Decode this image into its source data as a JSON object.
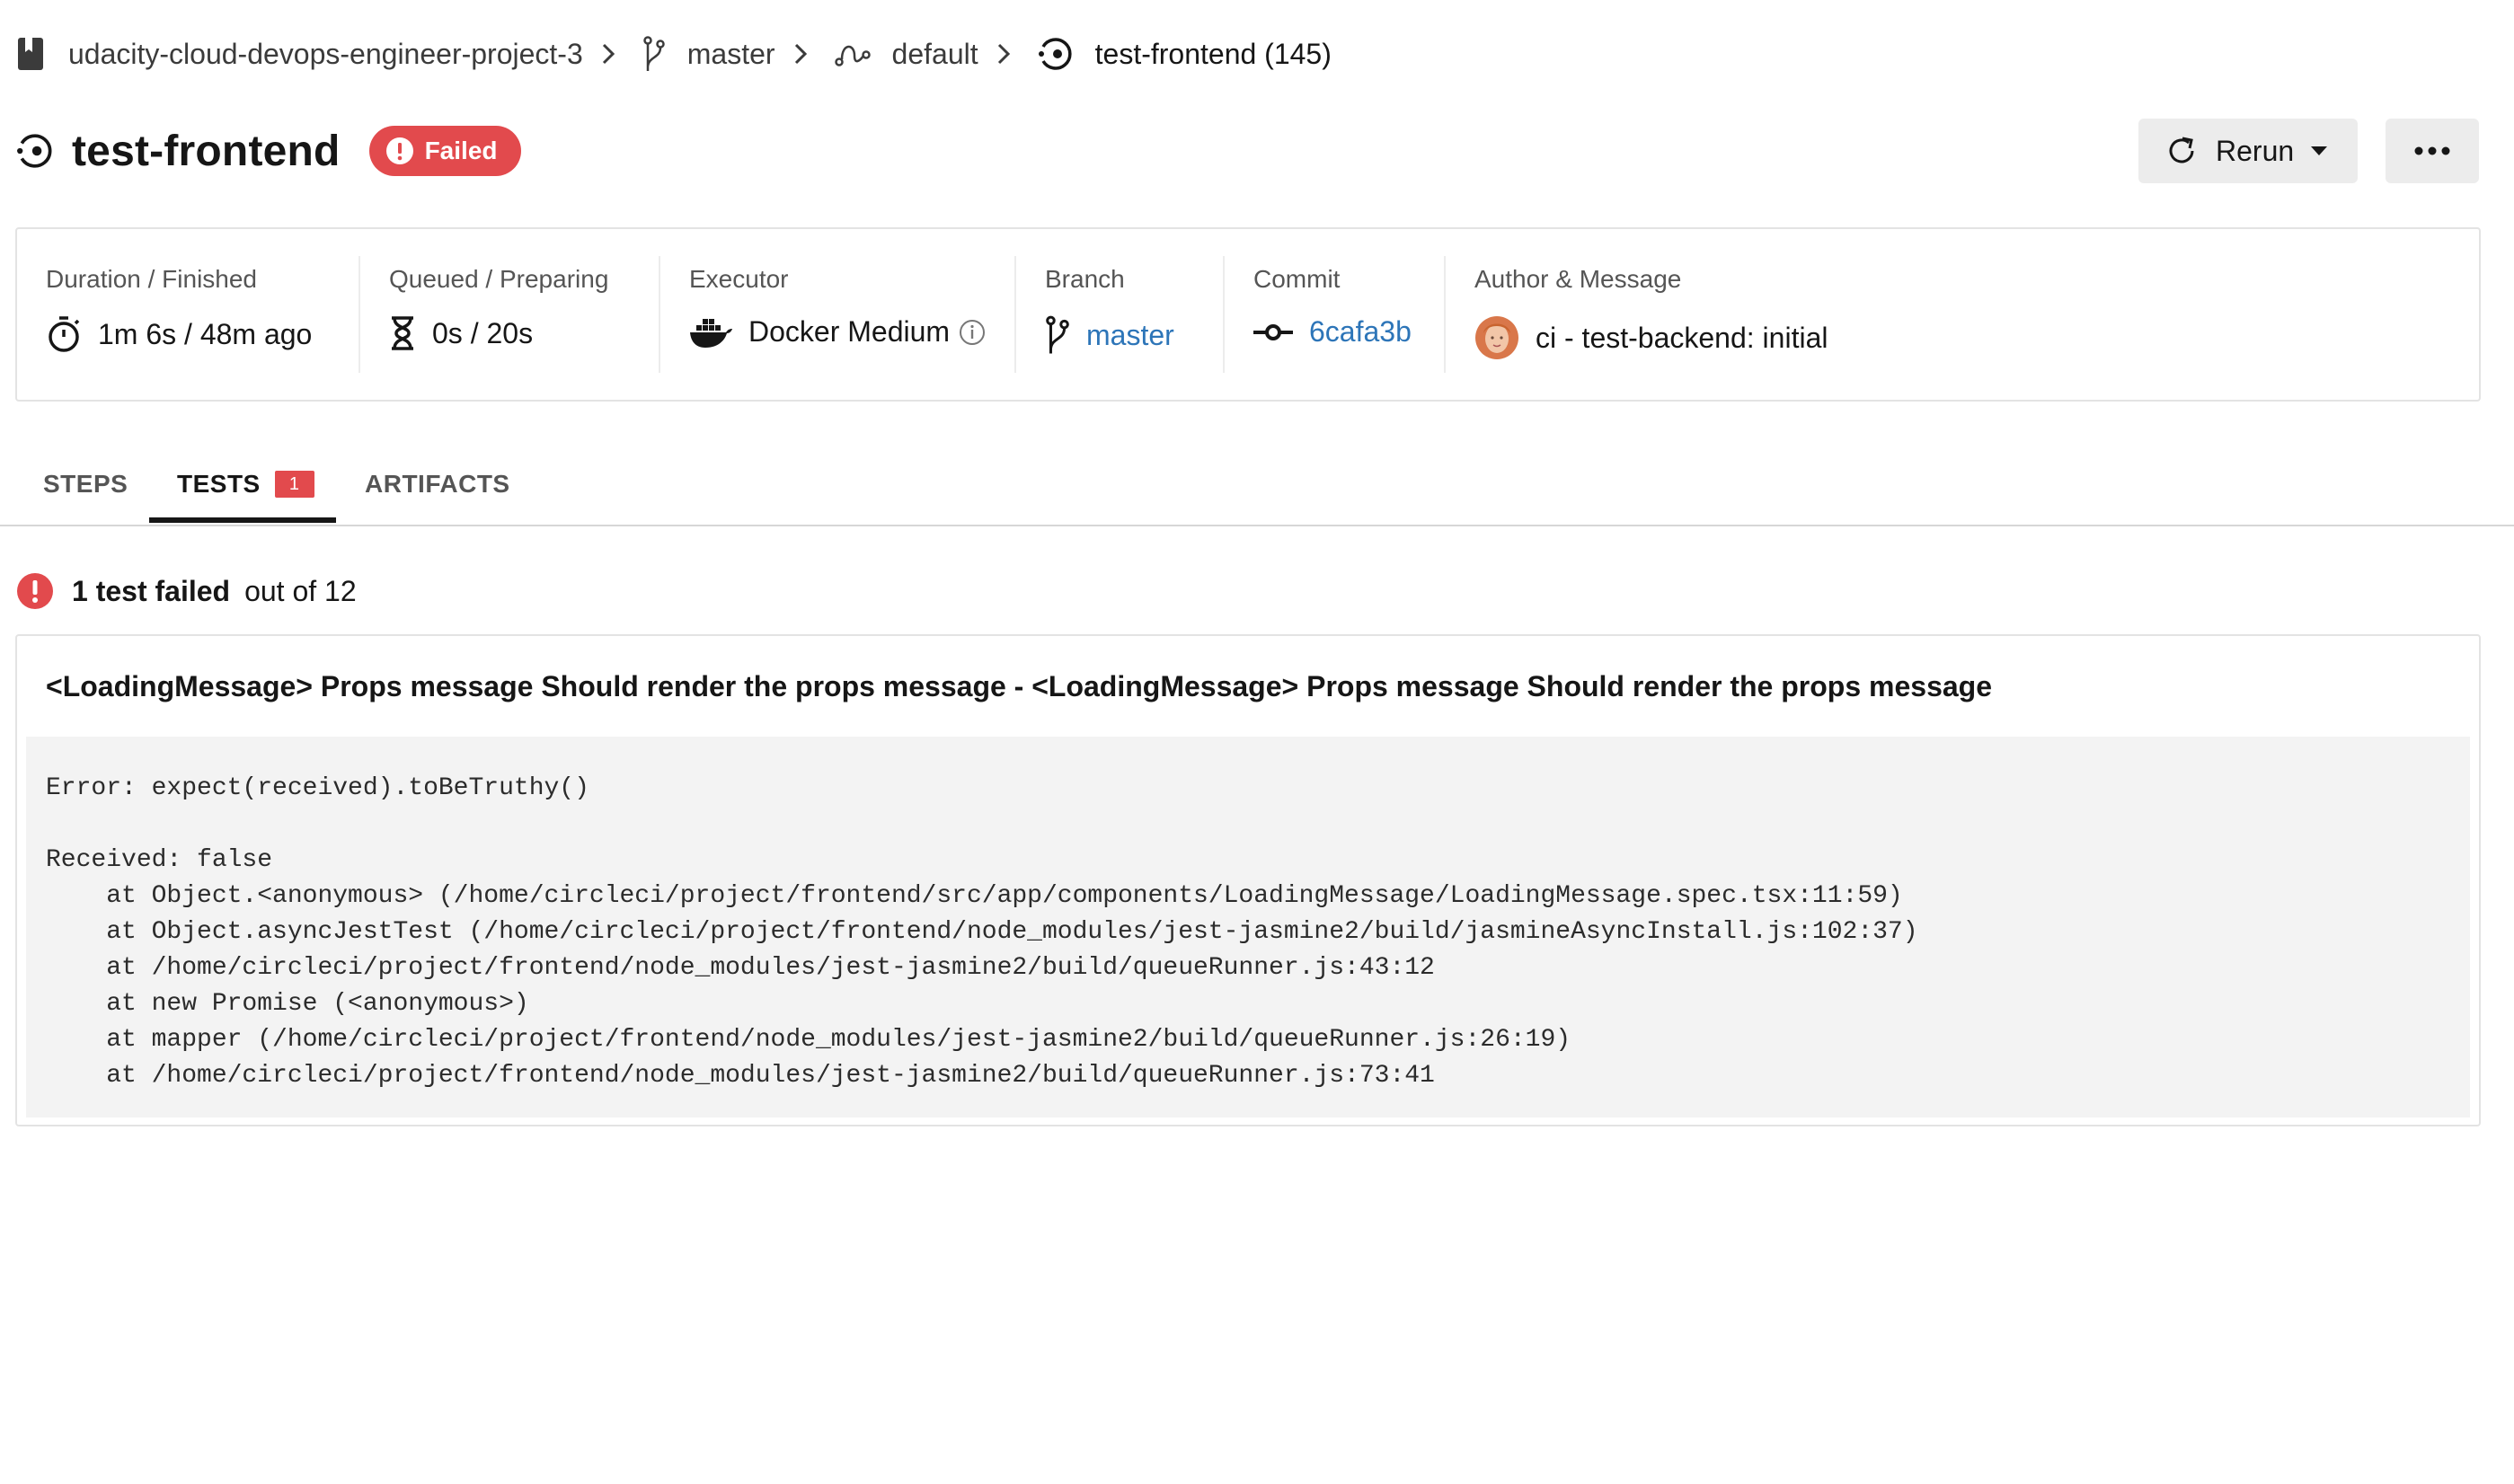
{
  "breadcrumb": {
    "project": "udacity-cloud-devops-engineer-project-3",
    "branch": "master",
    "workflow": "default",
    "job": "test-frontend (145)"
  },
  "header": {
    "job_title": "test-frontend",
    "status": "Failed",
    "rerun_label": "Rerun"
  },
  "info": {
    "duration": {
      "label": "Duration / Finished",
      "value": "1m 6s / 48m ago"
    },
    "queued": {
      "label": "Queued / Preparing",
      "value": "0s / 20s"
    },
    "executor": {
      "label": "Executor",
      "value": "Docker Medium"
    },
    "branch": {
      "label": "Branch",
      "value": "master"
    },
    "commit": {
      "label": "Commit",
      "value": "6cafa3b"
    },
    "author": {
      "label": "Author & Message",
      "value": "ci - test-backend: initial"
    }
  },
  "tabs": [
    {
      "label": "STEPS"
    },
    {
      "label": "TESTS",
      "count": "1"
    },
    {
      "label": "ARTIFACTS"
    }
  ],
  "tests": {
    "failed_text": "1 test failed",
    "total_text": "out of 12",
    "failed_test_name": "<LoadingMessage> Props message Should render the props message - <LoadingMessage> Props message Should render the props message",
    "error_output": "Error: expect(received).toBeTruthy()\n\nReceived: false\n    at Object.<anonymous> (/home/circleci/project/frontend/src/app/components/LoadingMessage/LoadingMessage.spec.tsx:11:59)\n    at Object.asyncJestTest (/home/circleci/project/frontend/node_modules/jest-jasmine2/build/jasmineAsyncInstall.js:102:37)\n    at /home/circleci/project/frontend/node_modules/jest-jasmine2/build/queueRunner.js:43:12\n    at new Promise (<anonymous>)\n    at mapper (/home/circleci/project/frontend/node_modules/jest-jasmine2/build/queueRunner.js:26:19)\n    at /home/circleci/project/frontend/node_modules/jest-jasmine2/build/queueRunner.js:73:41"
  },
  "colors": {
    "failed": "#e24a4d",
    "link": "#2d75b8",
    "button_bg": "#ececec"
  },
  "icons": {
    "project": "book-icon",
    "branch": "git-branch-icon",
    "workflow": "workflow-icon",
    "job": "job-icon",
    "status": "exclamation-circle-icon",
    "rerun": "refresh-icon",
    "more": "ellipsis-icon",
    "duration": "stopwatch-icon",
    "queued": "hourglass-icon",
    "executor": "docker-icon",
    "info": "info-icon",
    "commit": "git-commit-icon",
    "author": "avatar"
  }
}
